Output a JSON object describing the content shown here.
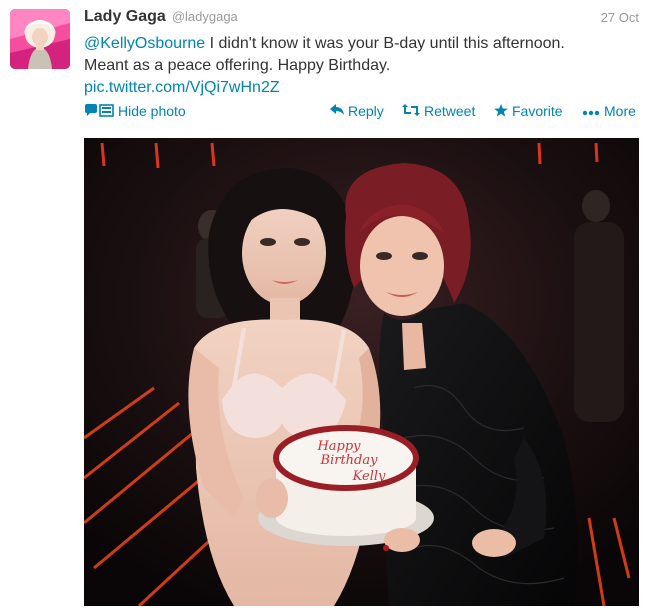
{
  "tweet": {
    "full_name": "Lady Gaga",
    "screen_name": "@ladygaga",
    "timestamp": "27 Oct",
    "mention": "@KellyOsbourne",
    "text_line1": " I didn't know it was your B-day until this afternoon.",
    "text_line2": "Meant as a peace offering. Happy Birthday.",
    "link": "pic.twitter.com/VjQi7wHn2Z"
  },
  "actions": {
    "hide_photo": "Hide photo",
    "reply": "Reply",
    "retweet": "Retweet",
    "favorite": "Favorite",
    "more": "More"
  },
  "photo": {
    "cake_text_line1": "Happy",
    "cake_text_line2": "Birthday",
    "cake_text_line3": "Kelly"
  },
  "colors": {
    "link": "#0084b4",
    "text": "#333333",
    "muted": "#999999",
    "photo_bg": "#120c0d"
  },
  "icons": {
    "hide_photo": "photo-icon",
    "reply": "reply-arrow-icon",
    "retweet": "retweet-icon",
    "favorite": "star-icon",
    "more": "ellipsis-icon"
  }
}
